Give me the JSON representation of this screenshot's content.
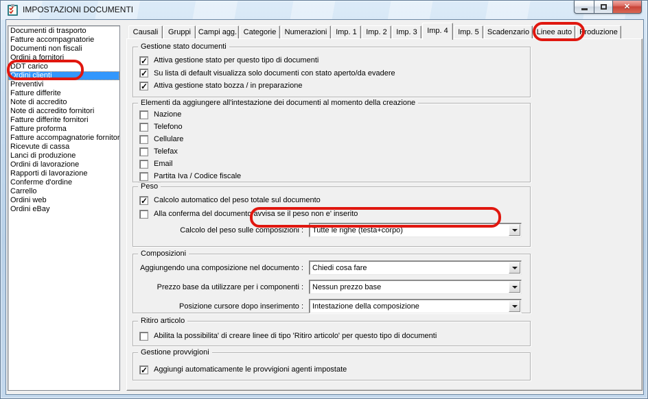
{
  "window": {
    "title": "IMPOSTAZIONI DOCUMENTI",
    "controls": {
      "minimize": "minimize",
      "maximize": "maximize",
      "close": "close"
    }
  },
  "colors": {
    "selection_blue": "#3297FD",
    "annotation_red": "#E0170F",
    "client_background": "#F0F0F0",
    "titlebar_glass": "#C7DCF0",
    "close_button_red": "#C94438"
  },
  "sidebar": {
    "items": [
      {
        "label": "Documenti di trasporto",
        "selected": false
      },
      {
        "label": "Fatture accompagnatorie",
        "selected": false
      },
      {
        "label": "Documenti non fiscali",
        "selected": false
      },
      {
        "label": "Ordini a fornitori",
        "selected": false
      },
      {
        "label": "DDT carico",
        "selected": false
      },
      {
        "label": "Ordini clienti",
        "selected": true
      },
      {
        "label": "Preventivi",
        "selected": false
      },
      {
        "label": "Fatture differite",
        "selected": false
      },
      {
        "label": "Note di accredito",
        "selected": false
      },
      {
        "label": "Note di accredito fornitori",
        "selected": false
      },
      {
        "label": "Fatture differite fornitori",
        "selected": false
      },
      {
        "label": "Fatture proforma",
        "selected": false
      },
      {
        "label": "Fatture accompagnatorie fornitori",
        "selected": false
      },
      {
        "label": "Ricevute di cassa",
        "selected": false
      },
      {
        "label": "Lanci di produzione",
        "selected": false
      },
      {
        "label": "Ordini di lavorazione",
        "selected": false
      },
      {
        "label": "Rapporti di lavorazione",
        "selected": false
      },
      {
        "label": "Conferme d'ordine",
        "selected": false
      },
      {
        "label": "Carrello",
        "selected": false
      },
      {
        "label": "Ordini web",
        "selected": false
      },
      {
        "label": "Ordini eBay",
        "selected": false
      }
    ]
  },
  "tabs": [
    {
      "label": "Causali",
      "active": false
    },
    {
      "label": "Gruppi",
      "active": false
    },
    {
      "label": "Campi agg.",
      "active": false
    },
    {
      "label": "Categorie",
      "active": false
    },
    {
      "label": "Numerazioni",
      "active": false
    },
    {
      "label": "Imp. 1",
      "active": false
    },
    {
      "label": "Imp. 2",
      "active": false
    },
    {
      "label": "Imp. 3",
      "active": false
    },
    {
      "label": "Imp. 4",
      "active": true
    },
    {
      "label": "Imp. 5",
      "active": false
    },
    {
      "label": "Scadenzario",
      "active": false
    },
    {
      "label": "Linee auto",
      "active": false
    },
    {
      "label": "Produzione",
      "active": false
    }
  ],
  "panel": {
    "groups": {
      "stato": {
        "title": "Gestione stato documenti",
        "checks": [
          {
            "label": "Attiva gestione stato per questo tipo di documenti",
            "checked": true
          },
          {
            "label": "Su lista di default visualizza solo documenti con stato aperto/da evadere",
            "checked": true
          },
          {
            "label": "Attiva gestione stato bozza / in preparazione",
            "checked": true
          }
        ]
      },
      "elementi": {
        "title": "Elementi da aggiungere all'intestazione dei documenti al momento della creazione",
        "checks": [
          {
            "label": "Nazione",
            "checked": false
          },
          {
            "label": "Telefono",
            "checked": false
          },
          {
            "label": "Cellulare",
            "checked": false
          },
          {
            "label": "Telefax",
            "checked": false
          },
          {
            "label": "Email",
            "checked": false
          },
          {
            "label": "Partita Iva / Codice fiscale",
            "checked": false
          }
        ]
      },
      "peso": {
        "title": "Peso",
        "checks": [
          {
            "label": "Calcolo automatico del peso totale sul documento",
            "checked": true
          },
          {
            "label": "Alla conferma del documento avvisa se il peso non e' inserito",
            "checked": false
          }
        ],
        "combo": {
          "label": "Calcolo del peso sulle composizioni :",
          "value": "Tutte le righe (testa+corpo)"
        }
      },
      "composizioni": {
        "title": "Composizioni",
        "combos": [
          {
            "label": "Aggiungendo una composizione nel documento :",
            "value": "Chiedi cosa fare"
          },
          {
            "label": "Prezzo base da utilizzare per i componenti :",
            "value": "Nessun prezzo base"
          },
          {
            "label": "Posizione cursore dopo inserimento :",
            "value": "Intestazione della composizione"
          }
        ]
      },
      "ritiro": {
        "title": "Ritiro articolo",
        "checks": [
          {
            "label": "Abilita la possibilita' di creare linee di tipo 'Ritiro articolo' per questo tipo di documenti",
            "checked": false
          }
        ]
      },
      "provvigioni": {
        "title": "Gestione provvigioni",
        "checks": [
          {
            "label": "Aggiungi automaticamente le provvigioni agenti impostate",
            "checked": true
          }
        ]
      }
    }
  },
  "annotations": {
    "color": "#E0170F",
    "marked": [
      "Ordini clienti",
      "Imp. 4",
      "Alla conferma del documento avvisa se il peso non e' inserito"
    ]
  }
}
